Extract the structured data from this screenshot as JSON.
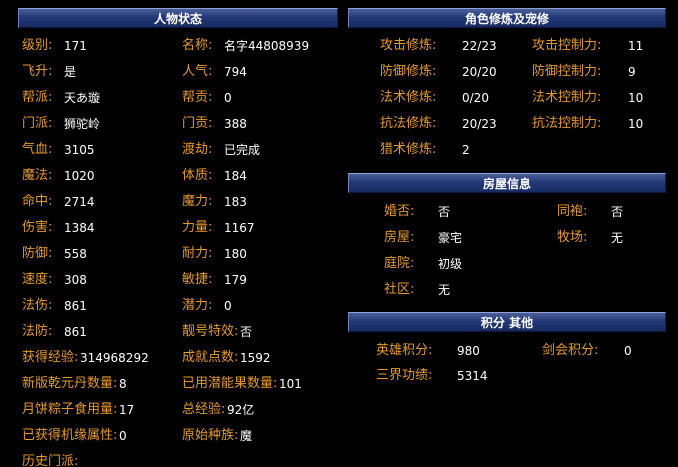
{
  "left_panel": {
    "title": "人物状态",
    "rows": [
      {
        "l1": "级别:",
        "v1": "171",
        "l2": "名称:",
        "v2": "名字44808939"
      },
      {
        "l1": "飞升:",
        "v1": "是",
        "l2": "人气:",
        "v2": "794"
      },
      {
        "l1": "帮派:",
        "v1": "天あ璇",
        "l2": "帮贡:",
        "v2": "0"
      },
      {
        "l1": "门派:",
        "v1": "狮驼岭",
        "l2": "门贡:",
        "v2": "388"
      },
      {
        "l1": "气血:",
        "v1": "3105",
        "l2": "渡劫:",
        "v2": "已完成"
      },
      {
        "l1": "魔法:",
        "v1": "1020",
        "l2": "体质:",
        "v2": "184"
      },
      {
        "l1": "命中:",
        "v1": "2714",
        "l2": "魔力:",
        "v2": "183"
      },
      {
        "l1": "伤害:",
        "v1": "1384",
        "l2": "力量:",
        "v2": "1167"
      },
      {
        "l1": "防御:",
        "v1": "558",
        "l2": "耐力:",
        "v2": "180"
      },
      {
        "l1": "速度:",
        "v1": "308",
        "l2": "敏捷:",
        "v2": "179"
      },
      {
        "l1": "法伤:",
        "v1": "861",
        "l2": "潜力:",
        "v2": "0"
      },
      {
        "l1": "法防:",
        "v1": "861",
        "l2": "靓号特效:",
        "v2": "否"
      },
      {
        "l1": "获得经验:",
        "v1": "314968292",
        "l2": "成就点数:",
        "v2": "1592"
      },
      {
        "l1": "新版乾元丹数量:",
        "v1": "8",
        "l2": "已用潜能果数量:",
        "v2": "101"
      },
      {
        "l1": "月饼粽子食用量:",
        "v1": "17",
        "l2": "总经验:",
        "v2": "92亿"
      },
      {
        "l1": "已获得机缘属性:",
        "v1": "0",
        "l2": "原始种族:",
        "v2": "魔"
      },
      {
        "l1": "历史门派:",
        "v1": "",
        "l2": "",
        "v2": ""
      }
    ]
  },
  "cultivation_panel": {
    "title": "角色修炼及宠修",
    "rows": [
      {
        "l1": "攻击修炼:",
        "v1": "22/23",
        "l2": "攻击控制力:",
        "v2": "11"
      },
      {
        "l1": "防御修炼:",
        "v1": "20/20",
        "l2": "防御控制力:",
        "v2": "9"
      },
      {
        "l1": "法术修炼:",
        "v1": "0/20",
        "l2": "法术控制力:",
        "v2": "10"
      },
      {
        "l1": "抗法修炼:",
        "v1": "20/23",
        "l2": "抗法控制力:",
        "v2": "10"
      },
      {
        "l1": "猎术修炼:",
        "v1": "2",
        "l2": "",
        "v2": ""
      }
    ]
  },
  "house_panel": {
    "title": "房屋信息",
    "rows": [
      {
        "l1": "婚否:",
        "v1": "否",
        "l2": "同袍:",
        "v2": "否"
      },
      {
        "l1": "房屋:",
        "v1": "豪宅",
        "l2": "牧场:",
        "v2": "无"
      },
      {
        "l1": "庭院:",
        "v1": "初级",
        "l2": "",
        "v2": ""
      },
      {
        "l1": "社区:",
        "v1": "无",
        "l2": "",
        "v2": ""
      }
    ]
  },
  "points_panel": {
    "title": "积分  其他",
    "rows": [
      {
        "l1": "英雄积分:",
        "v1": "980",
        "l2": "剑会积分:",
        "v2": "0"
      },
      {
        "l1": "三界功绩:",
        "v1": "5314",
        "l2": "",
        "v2": ""
      }
    ]
  }
}
